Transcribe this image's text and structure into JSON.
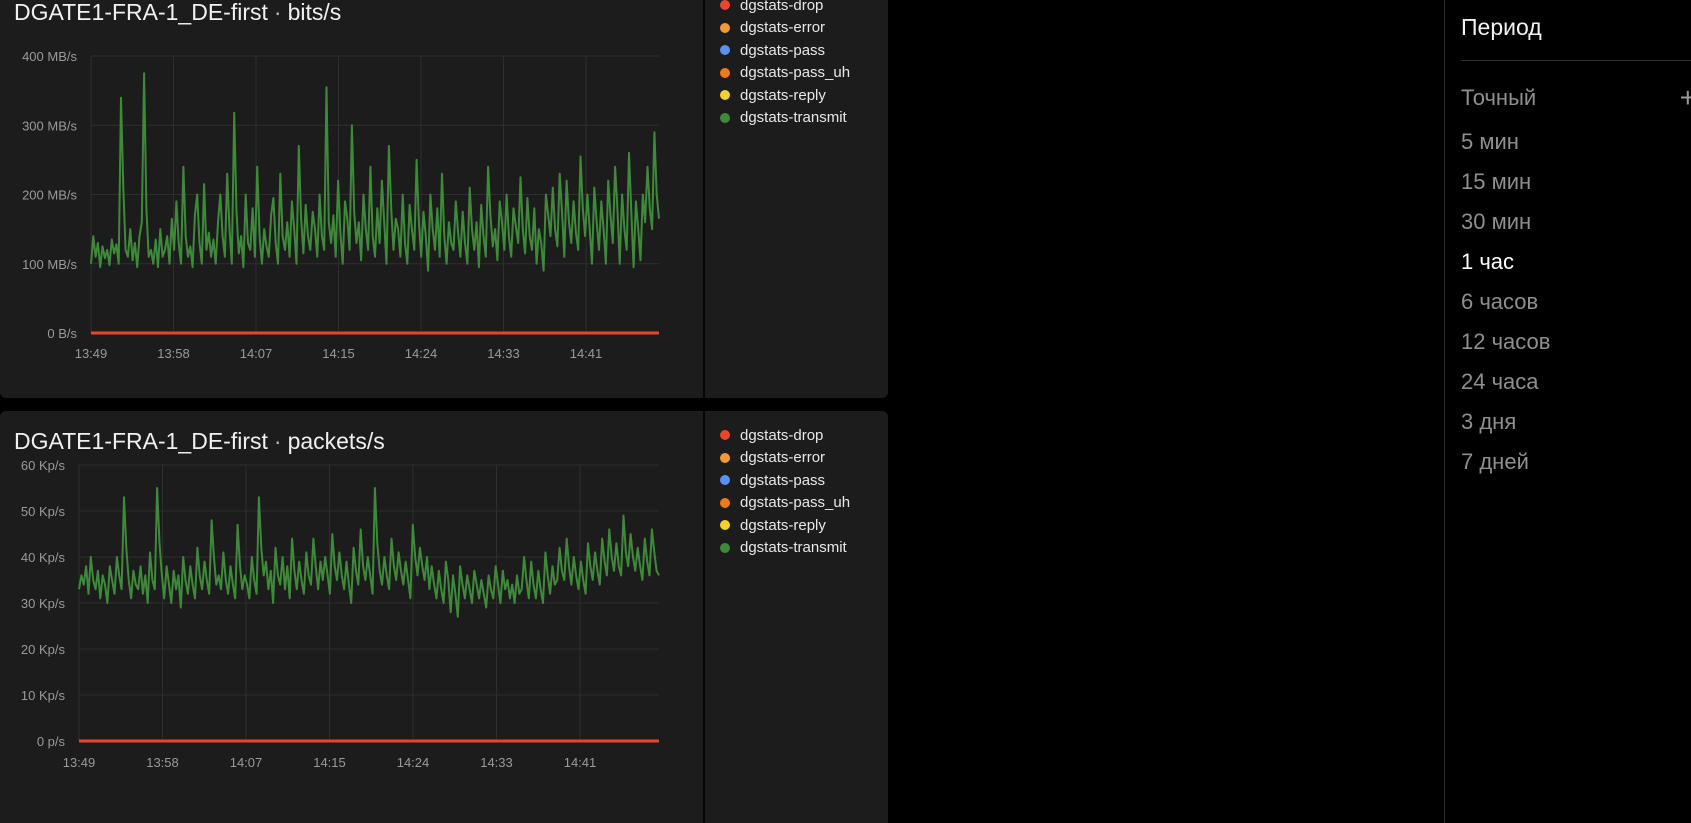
{
  "charts": [
    {
      "title_host": "DGATE1-FRA-1_DE-first",
      "title_metric": "bits/s",
      "legend": [
        {
          "label": "dgstats-drop",
          "color": "#e8452c"
        },
        {
          "label": "dgstats-error",
          "color": "#f29a38"
        },
        {
          "label": "dgstats-pass",
          "color": "#5b8ff0"
        },
        {
          "label": "dgstats-pass_uh",
          "color": "#f07a18"
        },
        {
          "label": "dgstats-reply",
          "color": "#f2d22e"
        },
        {
          "label": "dgstats-transmit",
          "color": "#3f8a3a"
        }
      ]
    },
    {
      "title_host": "DGATE1-FRA-1_DE-first",
      "title_metric": "packets/s",
      "legend": [
        {
          "label": "dgstats-drop",
          "color": "#e8452c"
        },
        {
          "label": "dgstats-error",
          "color": "#f29a38"
        },
        {
          "label": "dgstats-pass",
          "color": "#5b8ff0"
        },
        {
          "label": "dgstats-pass_uh",
          "color": "#f07a18"
        },
        {
          "label": "dgstats-reply",
          "color": "#f2d22e"
        },
        {
          "label": "dgstats-transmit",
          "color": "#3f8a3a"
        }
      ]
    }
  ],
  "chart_data": [
    {
      "type": "line",
      "title": "DGATE1-FRA-1_DE-first · bits/s",
      "x_ticks": [
        "13:49",
        "13:58",
        "14:07",
        "14:15",
        "14:24",
        "14:33",
        "14:41"
      ],
      "y_ticks": [
        "0 B/s",
        "100 MB/s",
        "200 MB/s",
        "300 MB/s",
        "400 MB/s"
      ],
      "ylim": [
        0,
        400
      ],
      "grid": true,
      "legend_position": "right",
      "series": [
        {
          "name": "dgstats-drop",
          "color": "#e8452c",
          "values": [
            0,
            0,
            0,
            0,
            0,
            0,
            0,
            0
          ]
        },
        {
          "name": "dgstats-transmit",
          "color": "#3f8a3a",
          "values": [
            100,
            140,
            110,
            130,
            95,
            125,
            108,
            120,
            98,
            135,
            115,
            128,
            100,
            340,
            210,
            120,
            110,
            150,
            105,
            130,
            95,
            140,
            160,
            375,
            180,
            110,
            120,
            100,
            135,
            95,
            150,
            110,
            120,
            140,
            100,
            165,
            120,
            190,
            130,
            100,
            240,
            140,
            110,
            125,
            95,
            170,
            200,
            130,
            100,
            215,
            120,
            145,
            110,
            135,
            100,
            160,
            200,
            140,
            110,
            230,
            150,
            100,
            318,
            175,
            115,
            140,
            95,
            200,
            130,
            120,
            180,
            110,
            240,
            140,
            100,
            150,
            125,
            110,
            170,
            195,
            130,
            100,
            230,
            140,
            120,
            160,
            110,
            190,
            150,
            100,
            270,
            165,
            115,
            185,
            140,
            120,
            175,
            150,
            110,
            200,
            140,
            120,
            355,
            160,
            130,
            170,
            110,
            220,
            145,
            100,
            190,
            165,
            120,
            300,
            175,
            130,
            160,
            105,
            200,
            150,
            120,
            240,
            140,
            110,
            180,
            130,
            220,
            160,
            100,
            270,
            180,
            120,
            165,
            150,
            110,
            200,
            130,
            100,
            185,
            150,
            120,
            250,
            160,
            110,
            175,
            140,
            90,
            200,
            150,
            120,
            180,
            110,
            230,
            140,
            100,
            160,
            130,
            120,
            190,
            145,
            110,
            175,
            130,
            100,
            210,
            150,
            120,
            160,
            95,
            185,
            140,
            110,
            240,
            170,
            125,
            150,
            105,
            190,
            160,
            120,
            200,
            140,
            110,
            180,
            155,
            130,
            225,
            150,
            115,
            195,
            140,
            120,
            180,
            100,
            150,
            130,
            90,
            200,
            170,
            140,
            210,
            150,
            125,
            230,
            175,
            110,
            220,
            160,
            130,
            190,
            145,
            120,
            255,
            180,
            140,
            200,
            150,
            100,
            210,
            160,
            120,
            190,
            150,
            100,
            220,
            170,
            130,
            240,
            180,
            100,
            200,
            150,
            120,
            260,
            175,
            95,
            190,
            150,
            105,
            200,
            160,
            240,
            180,
            150,
            290,
            200,
            165
          ]
        }
      ]
    },
    {
      "type": "line",
      "title": "DGATE1-FRA-1_DE-first · packets/s",
      "x_ticks": [
        "13:49",
        "13:58",
        "14:07",
        "14:15",
        "14:24",
        "14:33",
        "14:41"
      ],
      "y_ticks": [
        "0 p/s",
        "10 Kp/s",
        "20 Kp/s",
        "30 Kp/s",
        "40 Kp/s",
        "50 Kp/s",
        "60 Kp/s"
      ],
      "ylim": [
        0,
        60
      ],
      "grid": true,
      "legend_position": "right",
      "series": [
        {
          "name": "dgstats-drop",
          "color": "#e8452c",
          "values": [
            0,
            0,
            0,
            0,
            0,
            0,
            0,
            0
          ]
        },
        {
          "name": "dgstats-transmit",
          "color": "#3f8a3a",
          "values": [
            33,
            36,
            34,
            38,
            32,
            40,
            35,
            33,
            37,
            31,
            36,
            34,
            30,
            38,
            35,
            32,
            40,
            36,
            33,
            53,
            42,
            35,
            31,
            37,
            34,
            33,
            38,
            32,
            36,
            30,
            41,
            35,
            33,
            55,
            43,
            36,
            31,
            38,
            34,
            30,
            37,
            33,
            36,
            29,
            40,
            35,
            32,
            38,
            34,
            31,
            42,
            36,
            33,
            39,
            35,
            32,
            48,
            40,
            34,
            36,
            33,
            41,
            35,
            32,
            38,
            34,
            31,
            47,
            38,
            33,
            36,
            34,
            31,
            40,
            35,
            32,
            53,
            42,
            36,
            39,
            33,
            37,
            30,
            42,
            36,
            34,
            40,
            33,
            38,
            31,
            44,
            37,
            33,
            39,
            35,
            32,
            41,
            36,
            34,
            44,
            38,
            33,
            39,
            35,
            40,
            36,
            32,
            45,
            38,
            35,
            41,
            36,
            33,
            39,
            34,
            30,
            42,
            37,
            34,
            46,
            38,
            35,
            40,
            36,
            32,
            55,
            43,
            37,
            34,
            40,
            36,
            33,
            44,
            38,
            35,
            41,
            37,
            34,
            39,
            35,
            31,
            47,
            40,
            36,
            42,
            38,
            35,
            40,
            33,
            38,
            34,
            31,
            37,
            33,
            30,
            39,
            35,
            28,
            36,
            32,
            27,
            38,
            34,
            31,
            36,
            33,
            30,
            37,
            34,
            31,
            35,
            32,
            29,
            36,
            33,
            31,
            38,
            34,
            30,
            37,
            33,
            35,
            31,
            34,
            30,
            36,
            32,
            33,
            40,
            35,
            31,
            39,
            34,
            31,
            37,
            33,
            30,
            41,
            36,
            32,
            38,
            34,
            35,
            42,
            37,
            35,
            44,
            38,
            34,
            40,
            36,
            33,
            39,
            35,
            32,
            43,
            38,
            35,
            41,
            37,
            34,
            44,
            39,
            36,
            46,
            40,
            37,
            43,
            38,
            36,
            49,
            41,
            38,
            45,
            40,
            37,
            42,
            38,
            35,
            44,
            39,
            36,
            46,
            41,
            37,
            36
          ]
        }
      ]
    }
  ],
  "sidebar": {
    "title": "Период",
    "periods": [
      "Точный",
      "5 мин",
      "15 мин",
      "30 мин",
      "1 час",
      "6 часов",
      "12 часов",
      "24 часа",
      "3 дня",
      "7 дней"
    ],
    "active_period": "1 час",
    "add_icon": "plus-icon"
  }
}
